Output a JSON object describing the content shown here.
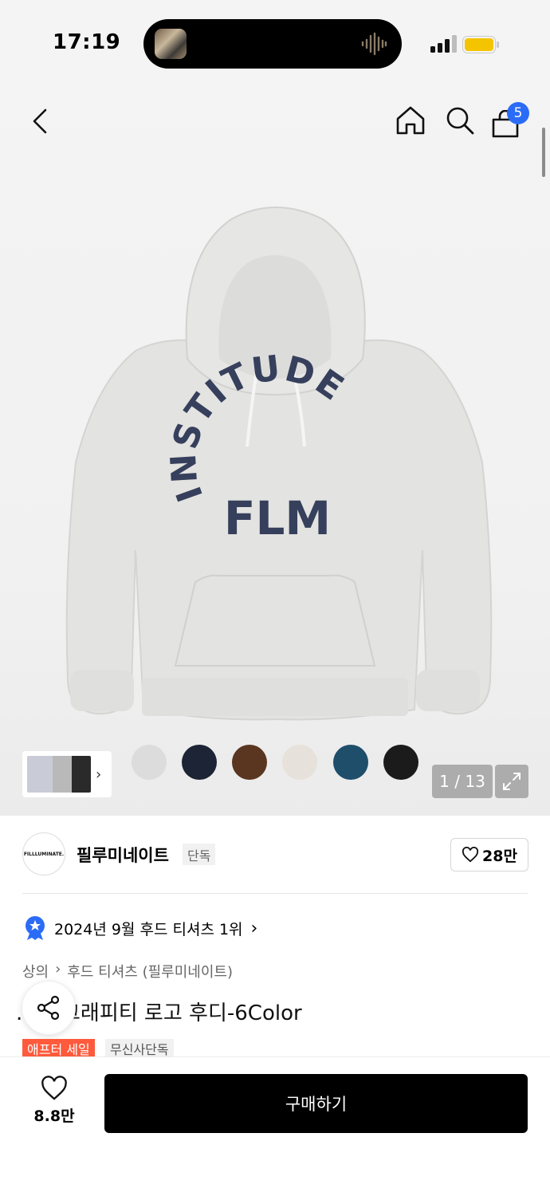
{
  "status_bar": {
    "time": "17:19"
  },
  "header": {
    "back_icon": "chevron-left-icon",
    "home_icon": "home-icon",
    "search_icon": "search-icon",
    "bag_icon": "shopping-bag-icon",
    "cart_count": "5"
  },
  "gallery": {
    "hoodie_print_line1": "INSTITUDE",
    "hoodie_print_line2": "FLM",
    "swatches": [
      "#dcdcdc",
      "#1c2435",
      "#5a3620",
      "#e6e1da",
      "#1f4e6b",
      "#1b1b1b"
    ],
    "image_counter": "1 / 13",
    "expand_icon": "expand-icon"
  },
  "brand": {
    "logo_text": "FILLLUMINATE.",
    "name": "필루미네이트",
    "tag": "단독",
    "likes": "28만"
  },
  "ranking": {
    "text": "2024년 9월 후드 티셔츠 1위"
  },
  "breadcrumb": {
    "category": "상의",
    "subcategory": "후드 티셔츠 (필루미네이트)"
  },
  "product": {
    "title": "...핏 그래피티 로고 후디-6Color",
    "tags": [
      "애프터 세일",
      "무신사단독"
    ]
  },
  "bottom_bar": {
    "wish_count": "8.8만",
    "buy_label": "구매하기"
  },
  "colors": {
    "accent_blue": "#2b6cf6",
    "sale_red": "#ff5a3c",
    "print_navy": "#36405c"
  }
}
